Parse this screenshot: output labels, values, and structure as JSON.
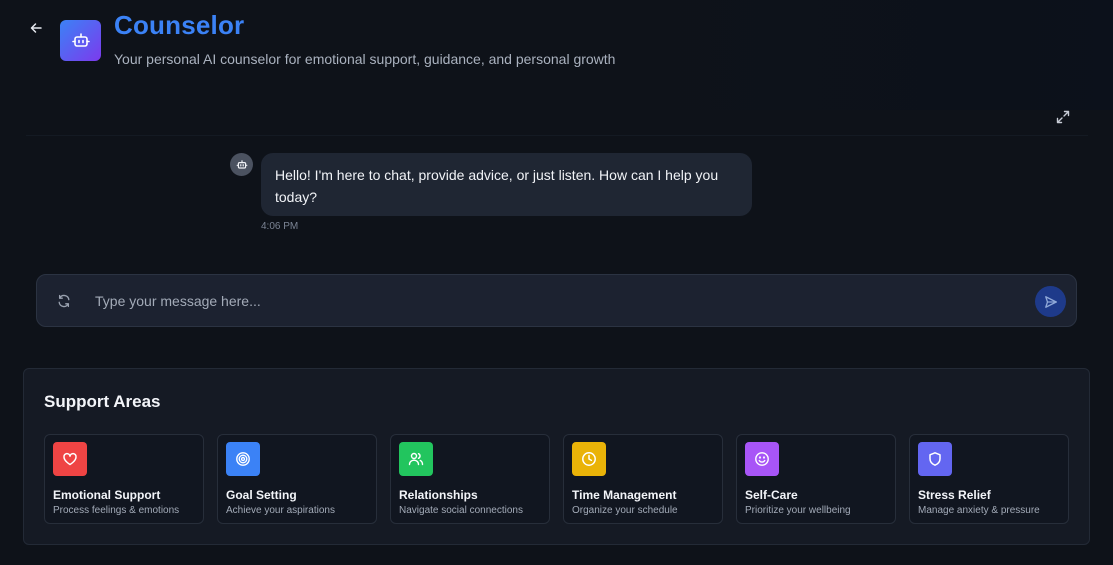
{
  "header": {
    "title": "Counselor",
    "subtitle": "Your personal AI counselor for emotional support, guidance, and personal growth",
    "back_icon": "arrow-left-icon",
    "logo_icon": "bot-icon",
    "expand_icon": "maximize-icon"
  },
  "chat": {
    "messages": [
      {
        "sender": "bot",
        "text": "Hello! I'm here to chat, provide advice, or just listen. How can I help you today?",
        "time": "4:06 PM"
      }
    ]
  },
  "composer": {
    "placeholder": "Type your message here...",
    "value": "",
    "refresh_icon": "refresh-icon",
    "send_icon": "send-icon"
  },
  "support": {
    "title": "Support Areas",
    "areas": [
      {
        "title": "Emotional Support",
        "description": "Process feelings & emotions",
        "icon": "heart-icon",
        "color": "#ef4444"
      },
      {
        "title": "Goal Setting",
        "description": "Achieve your aspirations",
        "icon": "target-icon",
        "color": "#3b82f6"
      },
      {
        "title": "Relationships",
        "description": "Navigate social connections",
        "icon": "users-icon",
        "color": "#22c55e"
      },
      {
        "title": "Time Management",
        "description": "Organize your schedule",
        "icon": "clock-icon",
        "color": "#eab308"
      },
      {
        "title": "Self-Care",
        "description": "Prioritize your wellbeing",
        "icon": "smile-icon",
        "color": "#a855f7"
      },
      {
        "title": "Stress Relief",
        "description": "Manage anxiety & pressure",
        "icon": "shield-icon",
        "color": "#6366f1"
      }
    ]
  },
  "colors": {
    "accent": "#3b82f6",
    "background": "#0e1219",
    "bubble": "#1f2633",
    "send_button": "#1e3a8a"
  }
}
